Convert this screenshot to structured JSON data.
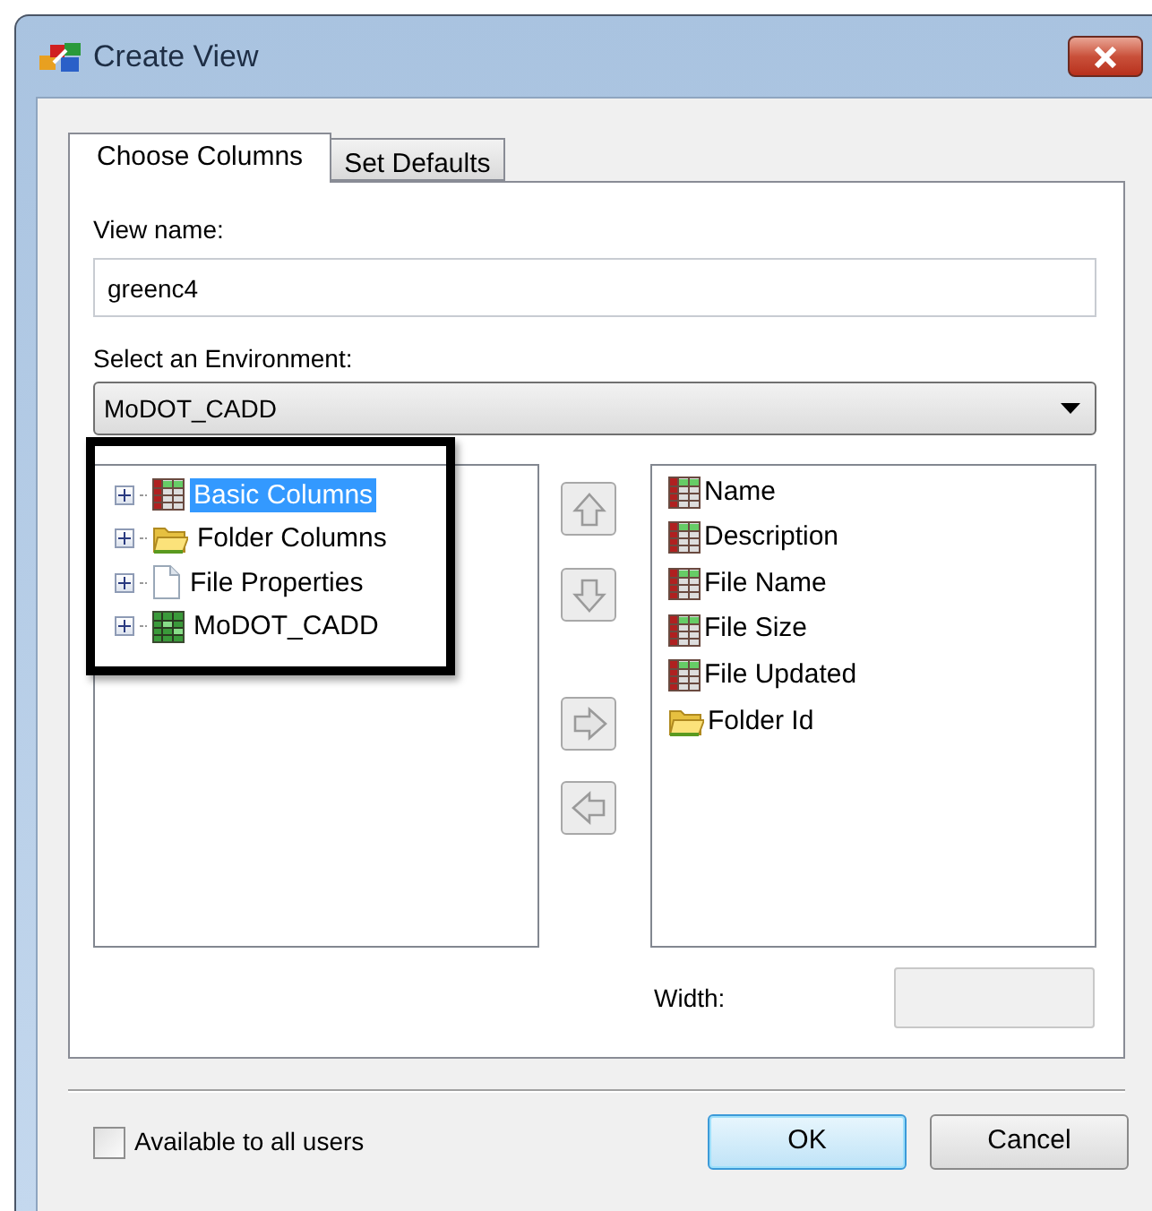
{
  "window": {
    "title": "Create View"
  },
  "tabs": [
    {
      "label": "Choose Columns",
      "selected": true
    },
    {
      "label": "Set Defaults",
      "selected": false
    }
  ],
  "view_name": {
    "label": "View name:",
    "value": "greenc4"
  },
  "environment": {
    "label": "Select an Environment:",
    "value": "MoDOT_CADD"
  },
  "tree": [
    {
      "label": "Basic Columns",
      "kind": "table",
      "selected": true,
      "expanded": false
    },
    {
      "label": "Folder Columns",
      "kind": "folder",
      "selected": false,
      "expanded": false
    },
    {
      "label": "File Properties",
      "kind": "file",
      "selected": false,
      "expanded": false
    },
    {
      "label": "MoDOT_CADD",
      "kind": "green_table",
      "selected": false,
      "expanded": false
    }
  ],
  "move_buttons": [
    {
      "kind": "up"
    },
    {
      "kind": "down"
    },
    {
      "kind": "right"
    },
    {
      "kind": "left"
    }
  ],
  "selected_columns": [
    {
      "label": "Name",
      "kind": "table"
    },
    {
      "label": "Description",
      "kind": "table"
    },
    {
      "label": "File Name",
      "kind": "table"
    },
    {
      "label": "File Size",
      "kind": "table"
    },
    {
      "label": "File Updated",
      "kind": "table"
    },
    {
      "label": "Folder Id",
      "kind": "folder"
    }
  ],
  "width": {
    "label": "Width:"
  },
  "available_to_all": {
    "label": "Available to all users",
    "checked": false
  },
  "buttons": [
    {
      "label": "OK",
      "kind": "default"
    },
    {
      "label": "Cancel",
      "kind": "normal"
    }
  ]
}
